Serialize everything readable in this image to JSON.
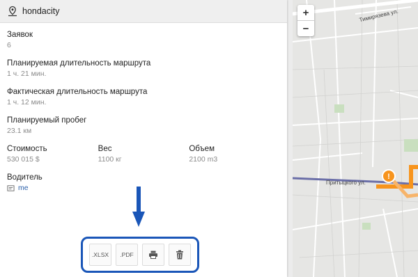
{
  "header": {
    "title": "hondacity",
    "icon": "map-pin-icon"
  },
  "fields": {
    "requests": {
      "label": "Заявок",
      "value": "6"
    },
    "planned_duration": {
      "label": "Планируемая длительность маршрута",
      "value": "1 ч. 21 мин."
    },
    "actual_duration": {
      "label": "Фактическая длительность маршрута",
      "value": "1 ч. 12 мин."
    },
    "planned_distance": {
      "label": "Планируемый пробег",
      "value": "23.1 км"
    },
    "cost": {
      "label": "Стоимость",
      "value": "530 015 $"
    },
    "weight": {
      "label": "Вес",
      "value": "1100 кг"
    },
    "volume": {
      "label": "Объем",
      "value": "2100 m3"
    },
    "driver": {
      "label": "Водитель",
      "value": "me"
    }
  },
  "toolbar": {
    "xlsx_label": ".XLSX",
    "pdf_label": ".PDF",
    "print_icon": "printer-icon",
    "delete_icon": "trash-icon",
    "highlight_color": "#1a56b8"
  },
  "map": {
    "zoom_in": "+",
    "zoom_out": "−",
    "street_top": "Тимирязева ул.",
    "street_mid": "Притыцкого ул.",
    "route_color": "#f7941d"
  }
}
